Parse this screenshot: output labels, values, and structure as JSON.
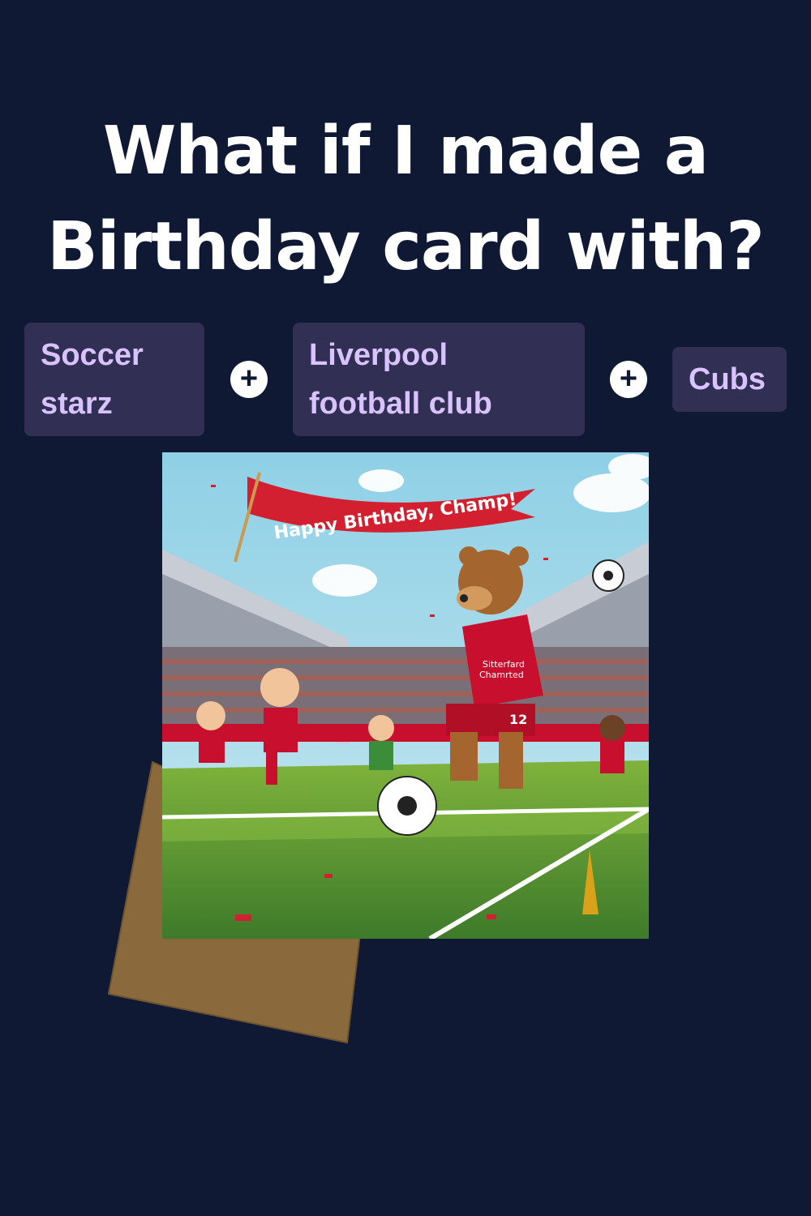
{
  "headline": {
    "line1": "What if I made a",
    "line2": "Birthday card with?"
  },
  "chips": [
    {
      "line1": "Soccer",
      "line2": "starz"
    },
    {
      "line1": "Liverpool",
      "line2": "football club"
    },
    {
      "line1": "Cubs"
    }
  ],
  "operators": [
    "+",
    "+"
  ],
  "card": {
    "banner": "Happy Birthday, Champ!",
    "jersey_sponsor_1": "Sitterfard",
    "jersey_sponsor_2": "Chamrted",
    "jersey_number": "12"
  },
  "colors": {
    "background": "#0f1933",
    "chip_bg": "#322f54",
    "chip_text": "#d8c3ff",
    "kit_red": "#c8102e",
    "envelope": "#8a6a3c"
  }
}
